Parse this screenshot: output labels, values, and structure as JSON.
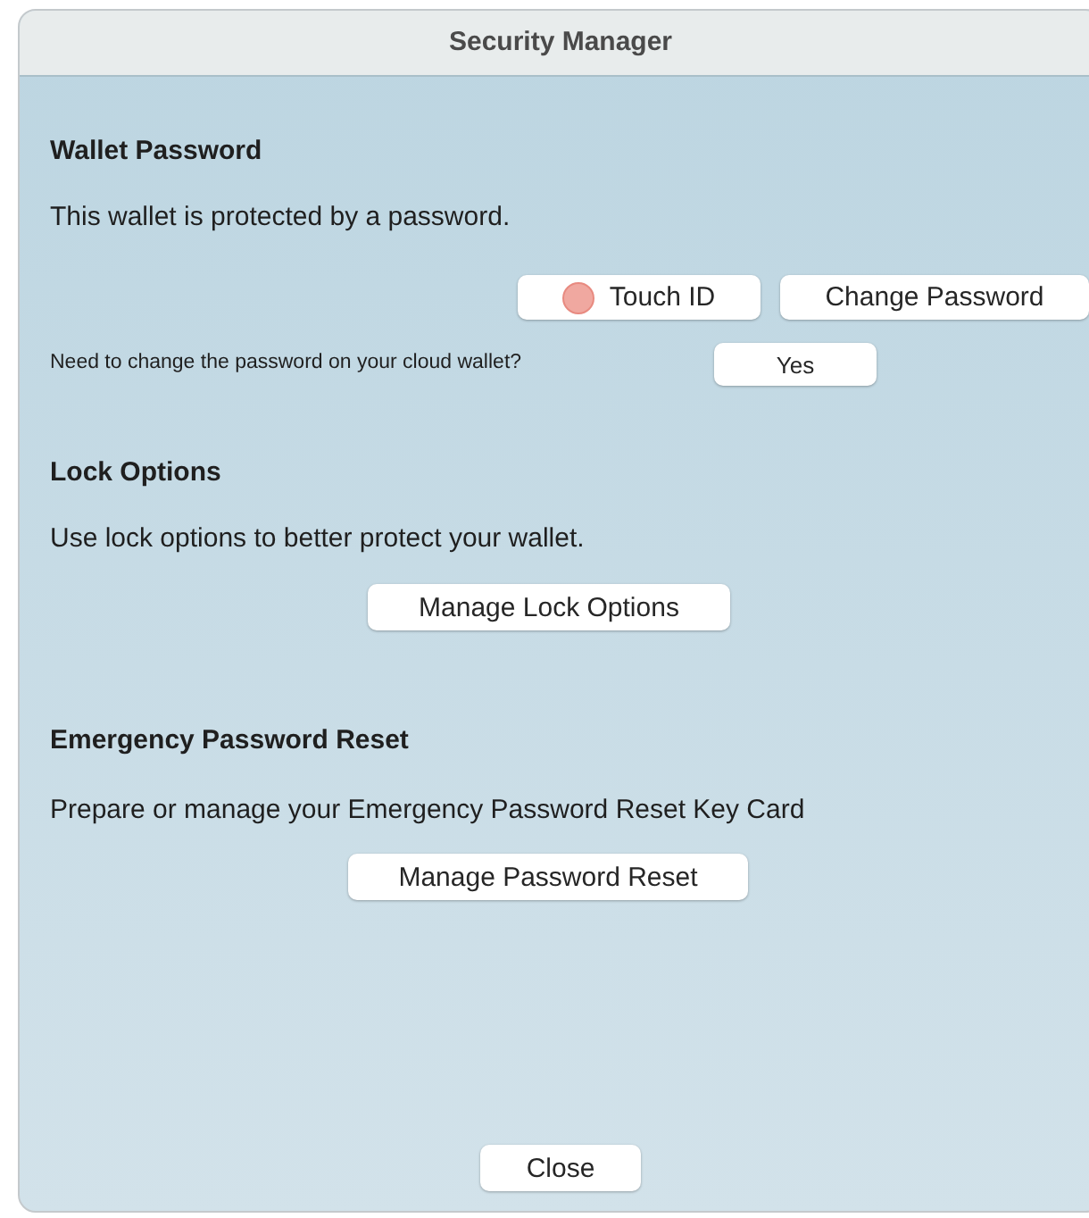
{
  "window": {
    "title": "Security Manager"
  },
  "wallet_password": {
    "heading": "Wallet Password",
    "description": "This wallet is protected by a password.",
    "touch_id_button": "Touch ID",
    "change_password_button": "Change Password",
    "cloud_prompt": "Need to change the password on your cloud wallet?",
    "cloud_button": "Yes"
  },
  "lock_options": {
    "heading": "Lock Options",
    "description": "Use lock options to better protect your wallet.",
    "button": "Manage Lock Options"
  },
  "emergency_reset": {
    "heading": "Emergency Password Reset",
    "description": "Prepare or manage your Emergency Password Reset Key Card",
    "button": "Manage Password Reset"
  },
  "close_button": "Close"
}
